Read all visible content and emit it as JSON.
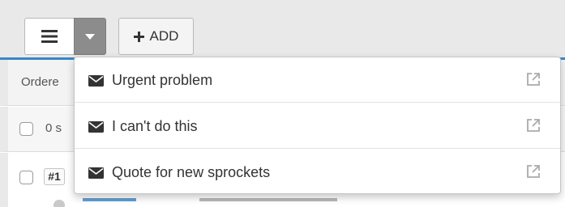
{
  "toolbar": {
    "menu_icon": "hamburger-icon",
    "caret_icon": "caret-down-icon",
    "add_label": "ADD",
    "add_icon": "plus-icon",
    "accent_color": "#3a86c8"
  },
  "list": {
    "header_text": "Ordere",
    "select_count_text": "0 s",
    "first_ticket_id": "#1"
  },
  "dropdown": {
    "items": [
      {
        "label": "Urgent problem",
        "icon": "envelope-icon",
        "action_icon": "external-link-icon"
      },
      {
        "label": "I can't do this",
        "icon": "envelope-icon",
        "action_icon": "external-link-icon"
      },
      {
        "label": "Quote for new sprockets",
        "icon": "envelope-icon",
        "action_icon": "external-link-icon"
      }
    ]
  }
}
